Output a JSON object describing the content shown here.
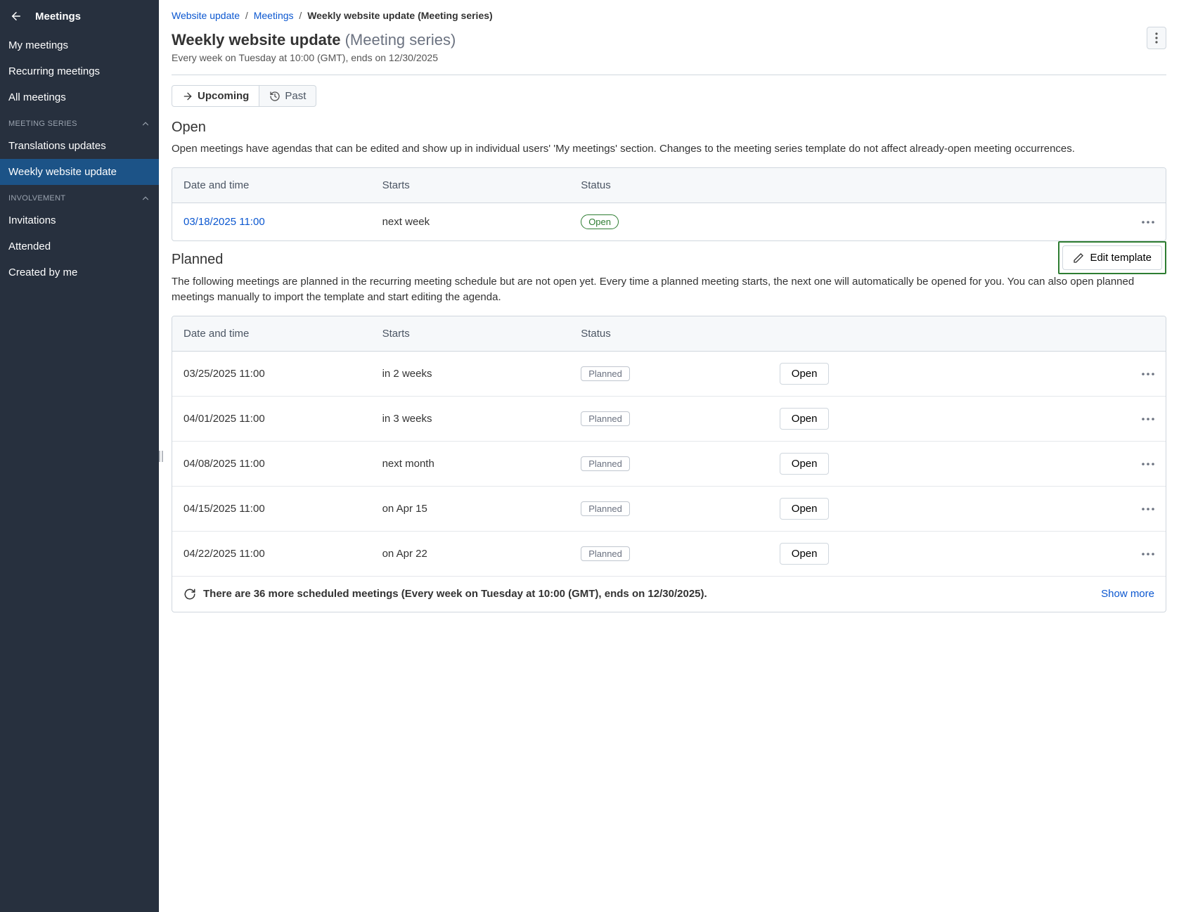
{
  "sidebar": {
    "title": "Meetings",
    "nav": [
      "My meetings",
      "Recurring meetings",
      "All meetings"
    ],
    "sections": [
      {
        "label": "MEETING SERIES",
        "items": [
          "Translations updates",
          "Weekly website update"
        ],
        "activeIndex": 1
      },
      {
        "label": "INVOLVEMENT",
        "items": [
          "Invitations",
          "Attended",
          "Created by me"
        ],
        "activeIndex": -1
      }
    ]
  },
  "breadcrumb": {
    "a": "Website update",
    "b": "Meetings",
    "current": "Weekly website update (Meeting series)"
  },
  "page": {
    "titleMain": "Weekly website update",
    "titleSuffix": "(Meeting series)",
    "subtitle": "Every week on Tuesday at 10:00 (GMT), ends on 12/30/2025"
  },
  "tabs": {
    "upcoming": "Upcoming",
    "past": "Past"
  },
  "open": {
    "heading": "Open",
    "desc": "Open meetings have agendas that can be edited and show up in individual users' 'My meetings' section. Changes to the meeting series template do not affect already-open meeting occurrences.",
    "headers": {
      "date": "Date and time",
      "starts": "Starts",
      "status": "Status"
    },
    "rows": [
      {
        "date": "03/18/2025 11:00",
        "starts": "next week",
        "status": "Open"
      }
    ]
  },
  "planned": {
    "heading": "Planned",
    "editTemplate": "Edit template",
    "desc": "The following meetings are planned in the recurring meeting schedule but are not open yet. Every time a planned meeting starts, the next one will automatically be opened for you. You can also open planned meetings manually to import the template and start editing the agenda.",
    "headers": {
      "date": "Date and time",
      "starts": "Starts",
      "status": "Status"
    },
    "openLabel": "Open",
    "rows": [
      {
        "date": "03/25/2025 11:00",
        "starts": "in 2 weeks",
        "status": "Planned"
      },
      {
        "date": "04/01/2025 11:00",
        "starts": "in 3 weeks",
        "status": "Planned"
      },
      {
        "date": "04/08/2025 11:00",
        "starts": "next month",
        "status": "Planned"
      },
      {
        "date": "04/15/2025 11:00",
        "starts": "on Apr 15",
        "status": "Planned"
      },
      {
        "date": "04/22/2025 11:00",
        "starts": "on Apr 22",
        "status": "Planned"
      }
    ],
    "footer": {
      "text": "There are 36 more scheduled meetings (Every week on Tuesday at 10:00 (GMT), ends on 12/30/2025).",
      "showMore": "Show more"
    }
  }
}
